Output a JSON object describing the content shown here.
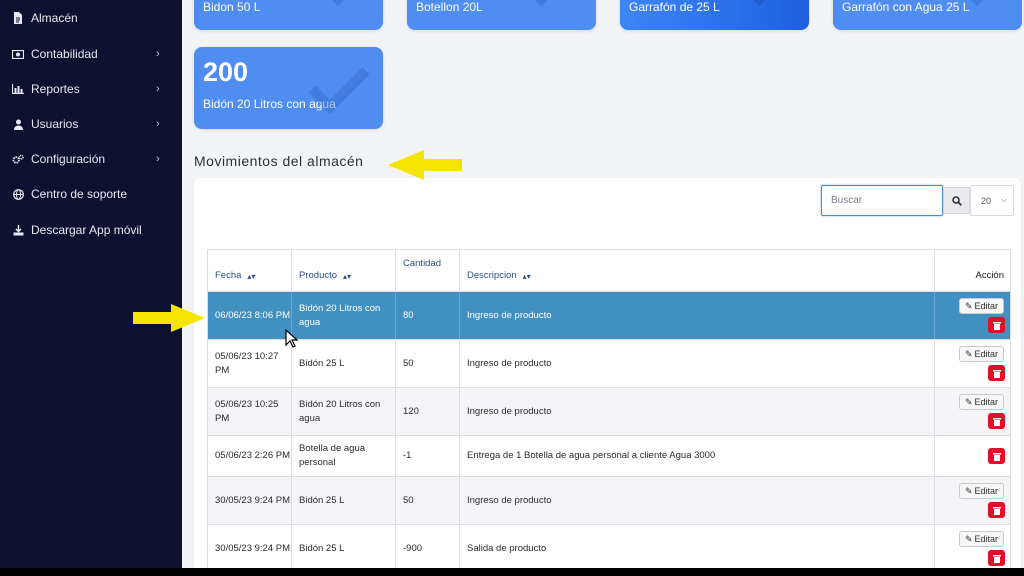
{
  "sidebar": {
    "items": [
      {
        "label": "Almacén",
        "icon": "document-icon",
        "has_submenu": false
      },
      {
        "label": "Contabilidad",
        "icon": "money-icon",
        "has_submenu": true
      },
      {
        "label": "Reportes",
        "icon": "bar-chart-icon",
        "has_submenu": true
      },
      {
        "label": "Usuarios",
        "icon": "users-icon",
        "has_submenu": true
      },
      {
        "label": "Configuración",
        "icon": "gears-icon",
        "has_submenu": true
      },
      {
        "label": "Centro de soporte",
        "icon": "globe-icon",
        "has_submenu": false
      },
      {
        "label": "Descargar App móvil",
        "icon": "download-icon",
        "has_submenu": false
      }
    ]
  },
  "cards": [
    {
      "name": "Bidon 50 L",
      "number": ""
    },
    {
      "name": "Botellon 20L",
      "number": ""
    },
    {
      "name": "Garrafón de 25 L",
      "number": ""
    },
    {
      "name": "Garrafón con Agua 25 L",
      "number": ""
    },
    {
      "name": "Bidón 20 Litros con agua",
      "number": "200"
    }
  ],
  "section": {
    "title": "Movimientos del almacén"
  },
  "search": {
    "placeholder": "Buscar",
    "value": ""
  },
  "page_size": {
    "selected": "20"
  },
  "table": {
    "headers": {
      "fecha": "Fecha",
      "producto": "Producto",
      "cantidad": "Cantidad",
      "descripcion": "Descripcion",
      "accion": "Acción"
    },
    "edit_label": "Editar",
    "rows": [
      {
        "fecha": "06/06/23 8:06 PM",
        "producto": "Bidón 20 Litros con agua",
        "cantidad": "80",
        "descripcion": "Ingreso de producto",
        "editable": true,
        "selected": true
      },
      {
        "fecha": "05/06/23 10:27 PM",
        "producto": "Bidón 25 L",
        "cantidad": "50",
        "descripcion": "Ingreso de producto",
        "editable": true,
        "selected": false
      },
      {
        "fecha": "05/06/23 10:25 PM",
        "producto": "Bidón 20 Litros con agua",
        "cantidad": "120",
        "descripcion": "Ingreso de producto",
        "editable": true,
        "selected": false
      },
      {
        "fecha": "05/06/23 2:26 PM",
        "producto": "Botella de agua personal",
        "cantidad": "-1",
        "descripcion": "Entrega de 1 Botella de agua personal a cliente Agua 3000",
        "editable": false,
        "selected": false
      },
      {
        "fecha": "30/05/23 9:24 PM",
        "producto": "Bidón 25 L",
        "cantidad": "50",
        "descripcion": "Ingreso de producto",
        "editable": true,
        "selected": false
      },
      {
        "fecha": "30/05/23 9:24 PM",
        "producto": "Bidón 25 L",
        "cantidad": "-900",
        "descripcion": "Salida de producto",
        "editable": true,
        "selected": false
      }
    ]
  },
  "colors": {
    "sidebar_bg": "#0c1130",
    "card_blue": "#4f8df0",
    "selected_row": "#428fc2",
    "delete_red": "#e0102a",
    "annotation_yellow": "#f5e400"
  }
}
